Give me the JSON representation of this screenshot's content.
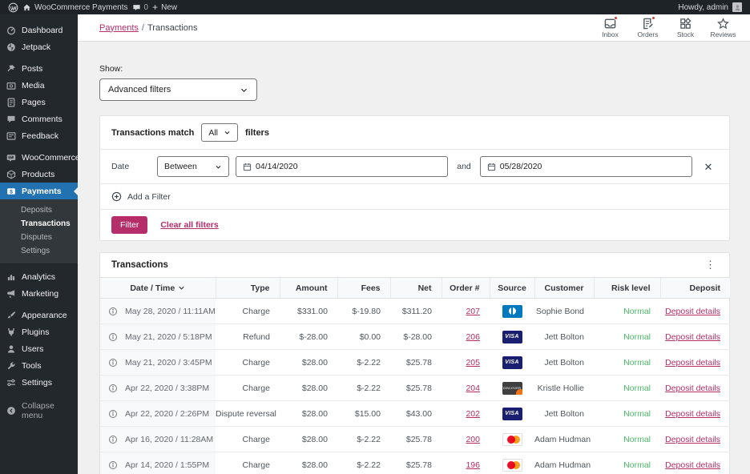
{
  "colors": {
    "accent_pink": "#b52e6a",
    "active_blue": "#2271b1",
    "risk_green": "#4ab866",
    "notification_red": "#d63638",
    "admin_bar_bg": "#1d2327",
    "sidebar_bg": "#23282d"
  },
  "admin_bar": {
    "site_name": "WooCommerce Payments",
    "comment_count": "0",
    "new_label": "New",
    "howdy_label": "Howdy, admin"
  },
  "sidebar": {
    "items": [
      {
        "label": "Dashboard"
      },
      {
        "label": "Jetpack"
      },
      {
        "label": "Posts"
      },
      {
        "label": "Media"
      },
      {
        "label": "Pages"
      },
      {
        "label": "Comments"
      },
      {
        "label": "Feedback"
      },
      {
        "label": "WooCommerce"
      },
      {
        "label": "Products"
      },
      {
        "label": "Payments"
      },
      {
        "label": "Analytics"
      },
      {
        "label": "Marketing"
      },
      {
        "label": "Appearance"
      },
      {
        "label": "Plugins"
      },
      {
        "label": "Users"
      },
      {
        "label": "Tools"
      },
      {
        "label": "Settings"
      }
    ],
    "payments_submenu": [
      {
        "label": "Deposits"
      },
      {
        "label": "Transactions"
      },
      {
        "label": "Disputes"
      },
      {
        "label": "Settings"
      }
    ],
    "collapse_label": "Collapse menu"
  },
  "header": {
    "breadcrumb": {
      "parent": "Payments",
      "separator": "/",
      "current": "Transactions"
    },
    "activity": [
      {
        "label": "Inbox"
      },
      {
        "label": "Orders"
      },
      {
        "label": "Stock"
      },
      {
        "label": "Reviews"
      }
    ]
  },
  "filters": {
    "show_label": "Show:",
    "show_value": "Advanced filters",
    "match_prefix": "Transactions match",
    "match_value": "All",
    "match_suffix": "filters",
    "date_label": "Date",
    "date_rule": "Between",
    "date_from": "04/14/2020",
    "and_label": "and",
    "date_to": "05/28/2020",
    "add_filter_label": "Add a Filter",
    "filter_button_label": "Filter",
    "clear_all_label": "Clear all filters"
  },
  "table": {
    "title": "Transactions",
    "columns": [
      "Date / Time",
      "Type",
      "Amount",
      "Fees",
      "Net",
      "Order #",
      "Source",
      "Customer",
      "Risk level",
      "Deposit"
    ],
    "rows": [
      {
        "date": "May 28, 2020 / 11:11AM",
        "type": "Charge",
        "amount": "$331.00",
        "fees": "$-19.80",
        "net": "$311.20",
        "order": "207",
        "source": "diners",
        "customer": "Sophie Bond",
        "risk": "Normal",
        "deposit": "Deposit details"
      },
      {
        "date": "May 21, 2020 / 5:18PM",
        "type": "Refund",
        "amount": "$-28.00",
        "fees": "$0.00",
        "net": "$-28.00",
        "order": "206",
        "source": "visa",
        "customer": "Jett Bolton",
        "risk": "Normal",
        "deposit": "Deposit details"
      },
      {
        "date": "May 21, 2020 / 3:45PM",
        "type": "Charge",
        "amount": "$28.00",
        "fees": "$-2.22",
        "net": "$25.78",
        "order": "205",
        "source": "visa",
        "customer": "Jett Bolton",
        "risk": "Normal",
        "deposit": "Deposit details"
      },
      {
        "date": "Apr 22, 2020 / 3:38PM",
        "type": "Charge",
        "amount": "$28.00",
        "fees": "$-2.22",
        "net": "$25.78",
        "order": "204",
        "source": "discover",
        "customer": "Kristle Hollie",
        "risk": "Normal",
        "deposit": "Deposit details"
      },
      {
        "date": "Apr 22, 2020 / 2:26PM",
        "type": "Dispute reversal",
        "amount": "$28.00",
        "fees": "$15.00",
        "net": "$43.00",
        "order": "202",
        "source": "visa",
        "customer": "Jett Bolton",
        "risk": "Normal",
        "deposit": "Deposit details"
      },
      {
        "date": "Apr 16, 2020 / 11:28AM",
        "type": "Charge",
        "amount": "$28.00",
        "fees": "$-2.22",
        "net": "$25.78",
        "order": "200",
        "source": "mastercard",
        "customer": "Adam Hudman",
        "risk": "Normal",
        "deposit": "Deposit details"
      },
      {
        "date": "Apr 14, 2020 / 1:55PM",
        "type": "Charge",
        "amount": "$28.00",
        "fees": "$-2.22",
        "net": "$25.78",
        "order": "196",
        "source": "mastercard",
        "customer": "Adam Hudman",
        "risk": "Normal",
        "deposit": "Deposit details"
      }
    ]
  }
}
